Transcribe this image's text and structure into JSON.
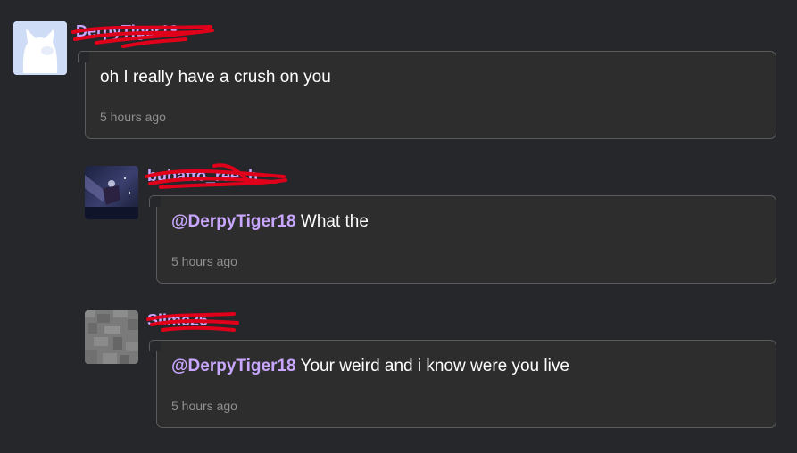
{
  "comments": [
    {
      "username": "DerpyTiger18",
      "mention": "",
      "text": "oh I really have a crush on you",
      "time": "5 hours ago"
    },
    {
      "username": "bubatto_reesh",
      "mention": "@DerpyTiger18",
      "text": " What the",
      "time": "5 hours ago"
    },
    {
      "username": "Slime26",
      "mention": "@DerpyTiger18",
      "text": " Your weird and i know were you live",
      "time": "5 hours ago"
    }
  ],
  "colors": {
    "background": "#25272b",
    "bubble": "#2d2d2d",
    "border": "#5b5b5b",
    "username": "#c9a7ff",
    "scribble": "#e0001a"
  },
  "icons": {
    "avatar1": "cat-avatar-icon",
    "avatar2": "night-scene-avatar-icon",
    "avatar3": "stone-block-avatar-icon"
  }
}
